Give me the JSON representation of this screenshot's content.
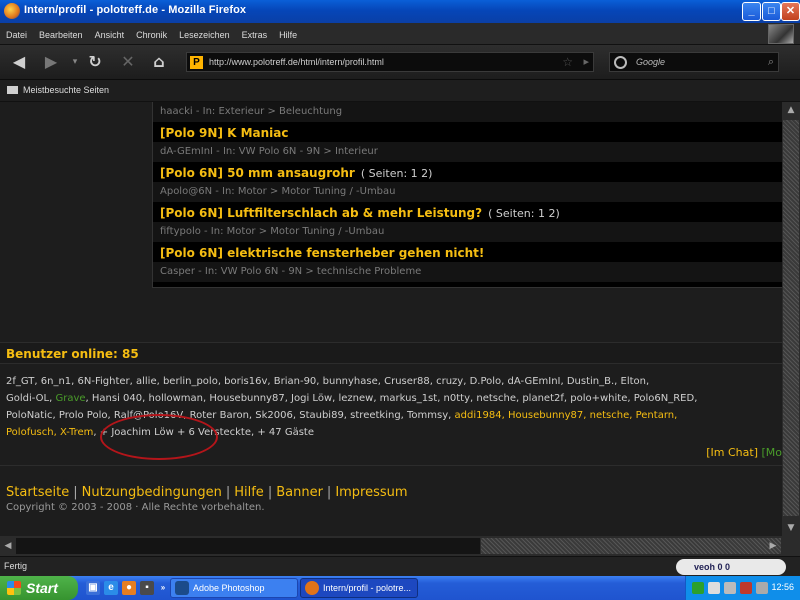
{
  "window": {
    "title": "Intern/profil - polotreff.de - Mozilla Firefox"
  },
  "menu": [
    "Datei",
    "Bearbeiten",
    "Ansicht",
    "Chronik",
    "Lesezeichen",
    "Extras",
    "Hilfe"
  ],
  "nav": {
    "url": "http://www.polotreff.de/html/intern/profil.html",
    "search_placeholder": "Google"
  },
  "bookmarks": {
    "item": "Meistbesuchte Seiten"
  },
  "threads": [
    {
      "title": "",
      "pages": "",
      "meta": "haacki - In: Exterieur > Beleuchtung"
    },
    {
      "title": "[Polo 9N] K Maniac",
      "pages": "",
      "meta": "dA-GEmInI - In: VW Polo 6N - 9N > Interieur"
    },
    {
      "title": "[Polo 6N] 50 mm ansaugrohr",
      "pages": "( Seiten: 1 2)",
      "meta": "Apolo@6N - In: Motor > Motor Tuning / -Umbau"
    },
    {
      "title": "[Polo 6N] Luftfilterschlach ab & mehr Leistung?",
      "pages": "( Seiten: 1 2)",
      "meta": "fiftypolo - In: Motor > Motor Tuning / -Umbau"
    },
    {
      "title": "[Polo 6N] elektrische fensterheber gehen nicht!",
      "pages": "",
      "meta": "Casper - In: VW Polo 6N - 9N > technische Probleme"
    }
  ],
  "online": {
    "heading": "Benutzer online: 85",
    "line1": "2f_GT, 6n_n1, 6N-Fighter, allie, berlin_polo, boris16v, Brian-90, bunnyhase, Cruser88, cruzy, D.Polo, dA-GEmInI, Dustin_B., Elton,",
    "line2_pre": "Goldi-OL, ",
    "line2_green": "Grave",
    "line2_post": ", Hansi 040, hollowman, Housebunny87, Jogi Löw, leznew, markus_1st, n0tty, netsche, planet2f, polo+white, Polo6N_RED,",
    "line3_pre": "PoloNatic, Prolo Polo, Ralf@Polo16V, Roter Baron, Sk2006, Staubi89, streetking, Tommsy, ",
    "line3_yellow": "addi1984, Housebunny87, netsche, Pentarn,",
    "line4_yellow": "Polofusch, X-Trem",
    "line4_post": ", + Joachim Löw + 6 Versteckte, + 47 Gäste",
    "chat": "[Im Chat]",
    "more": "[Mo"
  },
  "footer": {
    "links": [
      "Startseite",
      "Nutzungbedingungen",
      "Hilfe",
      "Banner",
      "Impressum"
    ],
    "copyright": "Copyright © 2003 - 2008 · Alle Rechte vorbehalten."
  },
  "status": {
    "text": "Fertig",
    "veoh": "veoh  0  0"
  },
  "taskbar": {
    "start": "Start",
    "tasks": [
      "Adobe Photoshop",
      "Intern/profil - polotre..."
    ],
    "time": "12:56"
  }
}
